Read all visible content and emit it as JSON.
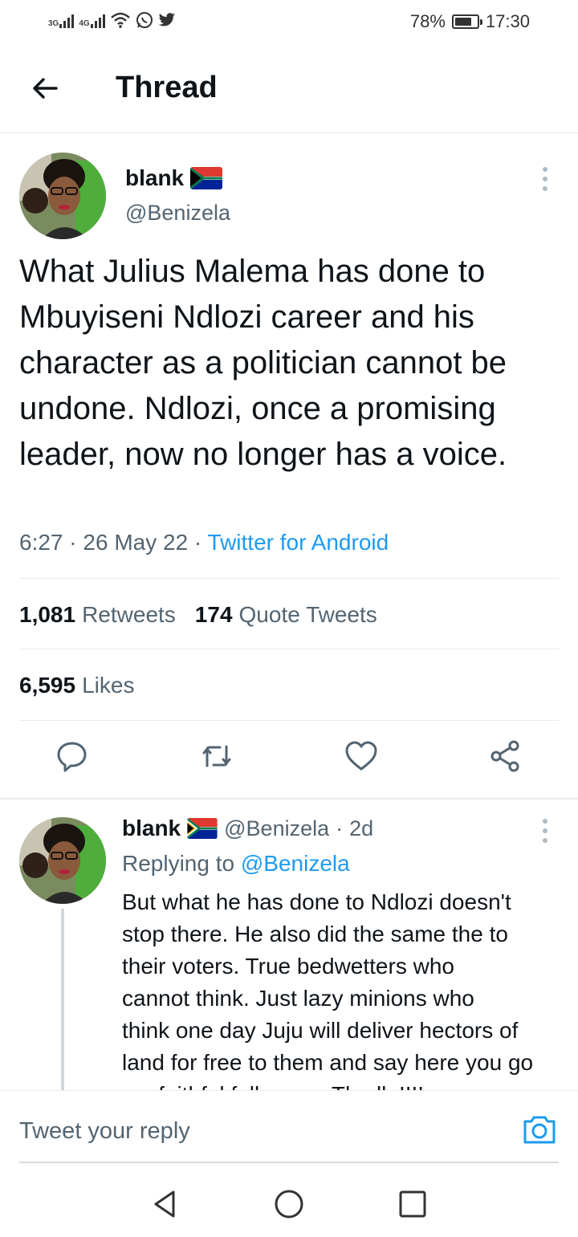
{
  "status_bar": {
    "net1": "3G",
    "net2": "4G",
    "battery": "78%",
    "battery_level": 0.78,
    "time": "17:30",
    "icons": [
      "signal-icon",
      "signal-icon",
      "wifi-icon",
      "whatsapp-icon",
      "twitter-icon",
      "battery-icon"
    ]
  },
  "header": {
    "title": "Thread",
    "back_icon": "back-arrow-icon"
  },
  "tweet": {
    "name": "blank",
    "handle": "@Benizela",
    "text": "What Julius Malema has done to Mbuyiseni Ndlozi career and his character as a politician cannot be undone. Ndlozi, once a promising leader, now no longer has a voice.",
    "time": "6:27",
    "date": "26 May 22",
    "source": "Twitter for Android",
    "retweets_count": "1,081",
    "retweets_label": "Retweets",
    "quotes_count": "174",
    "quotes_label": "Quote Tweets",
    "likes_count": "6,595",
    "likes_label": "Likes"
  },
  "reply": {
    "name": "blank",
    "handle": "@Benizela",
    "age": "2d",
    "replying_label": "Replying to",
    "replying_to": "@Benizela",
    "text": "But what he has done to Ndlozi doesn't\nstop there. He also did the same the to\ntheir voters. True bedwetters who\ncannot think. Just lazy minions who\nthink one day Juju will deliver hectors of\nland for free to them and say here you go\nmy faithful followers. The ll..!!!!"
  },
  "composer": {
    "placeholder": "Tweet your reply"
  },
  "colors": {
    "accent": "#1d9bf0",
    "secondary_text": "#536471",
    "divider": "#e6ecf0"
  }
}
